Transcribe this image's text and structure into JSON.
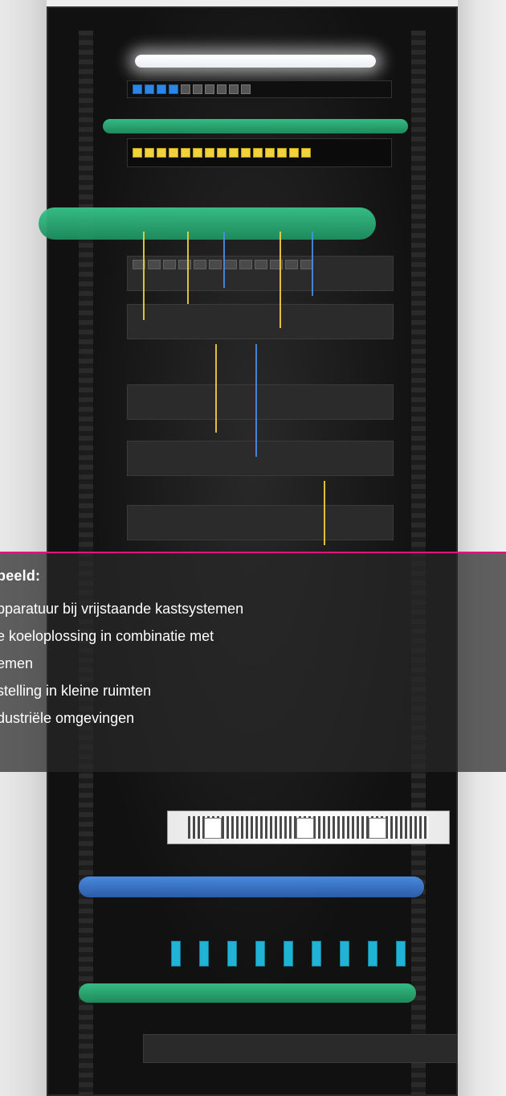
{
  "overlay": {
    "heading": "beeld:",
    "bullets": [
      "pparatuur bij vrijstaande kastsystemen",
      "e koeloplossing in combinatie met",
      "emen",
      "stelling in kleine ruimten",
      "dustriële omgevingen"
    ]
  },
  "colors": {
    "accent": "#e0147a",
    "overlay": "#2a2a2a",
    "text": "#ffffff",
    "cable_green": "#2cc37b",
    "cable_yellow": "#f2d23a",
    "cable_blue": "#2a86e8"
  },
  "icons": {
    "patch-port": "small rectangle port",
    "fiber-connector": "lc connector"
  }
}
